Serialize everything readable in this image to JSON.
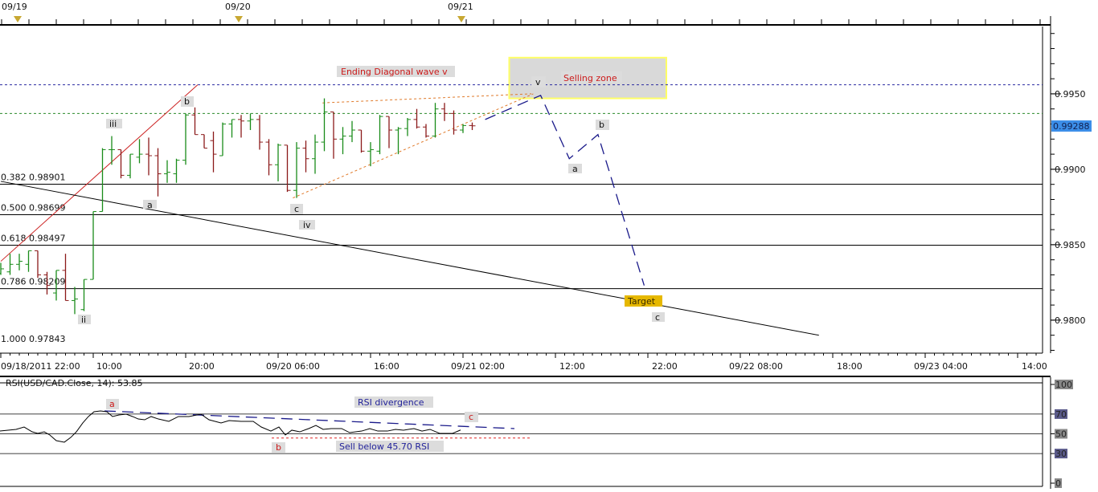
{
  "top_axis": {
    "dates": [
      "09/19",
      "09/20",
      "09/21"
    ]
  },
  "time_axis": {
    "labels": [
      "09/18/2011 22:00",
      "10:00",
      "20:00",
      "09/20 06:00",
      "16:00",
      "09/21 02:00",
      "12:00",
      "22:00",
      "09/22 08:00",
      "18:00",
      "09/23 04:00",
      "14:00"
    ]
  },
  "price_axis": {
    "ticks": [
      "0.9950",
      "0.9900",
      "0.9850",
      "0.9800"
    ],
    "last_price": "0.99288",
    "last_price_color": "#3c8ee8"
  },
  "fib_levels": [
    {
      "label": "0.382 0.98901",
      "price": 0.98901
    },
    {
      "label": "0.500 0.98699",
      "price": 0.98699
    },
    {
      "label": "0.618 0.98497",
      "price": 0.98497
    },
    {
      "label": "0.786 0.98209",
      "price": 0.98209
    },
    {
      "label": "1.000 0.97843",
      "price": 0.97843
    }
  ],
  "annotations": {
    "ending_diagonal": "Ending Diagonal wave v",
    "selling_zone": "Selling zone",
    "target": "Target",
    "waves": {
      "v": "v",
      "b1": "b",
      "iii": "iii",
      "a1": "a",
      "ii": "ii",
      "c1": "c",
      "iv": "iv",
      "a2": "a",
      "b2": "b",
      "c2": "c"
    }
  },
  "rsi": {
    "title": "RSI(USD/CAD.Close, 14): 53.85",
    "axis": [
      "100",
      "70",
      "50",
      "30",
      "0"
    ],
    "labels": {
      "a": "a",
      "b": "b",
      "c": "c",
      "divergence": "RSI divergence",
      "sell": "Sell below 45.70 RSI"
    }
  },
  "chart_data": [
    {
      "type": "ohlc",
      "title": "USD/CAD hourly",
      "x_unit": "hours since 09/18/2011 22:00",
      "ylim": [
        0.9776,
        0.9995
      ],
      "up_color": "#1a8c1a",
      "down_color": "#8b1a1a",
      "bars": [
        [
          0.9831,
          0.9838,
          0.983,
          0.9834
        ],
        [
          0.9832,
          0.9844,
          0.983,
          0.9837
        ],
        [
          0.9837,
          0.9844,
          0.9833,
          0.9839
        ],
        [
          0.9837,
          0.9846,
          0.9832,
          0.9846
        ],
        [
          0.9846,
          0.9846,
          0.9828,
          0.983
        ],
        [
          0.983,
          0.9832,
          0.9817,
          0.9823
        ],
        [
          0.9818,
          0.9833,
          0.9813,
          0.9833
        ],
        [
          0.9833,
          0.9844,
          0.9813,
          0.9813
        ],
        [
          0.9813,
          0.9822,
          0.9804,
          0.9814
        ],
        [
          0.9807,
          0.9827,
          0.9806,
          0.9827
        ],
        [
          0.9827,
          0.9872,
          0.9827,
          0.9872
        ],
        [
          0.9872,
          0.9914,
          0.9872,
          0.9913
        ],
        [
          0.9913,
          0.9922,
          0.9903,
          0.9913
        ],
        [
          0.9913,
          0.9913,
          0.9894,
          0.9896
        ],
        [
          0.9896,
          0.991,
          0.9894,
          0.991
        ],
        [
          0.9908,
          0.992,
          0.9904,
          0.991
        ],
        [
          0.991,
          0.9921,
          0.9896,
          0.9909
        ],
        [
          0.9909,
          0.9914,
          0.9882,
          0.9897
        ],
        [
          0.9897,
          0.9906,
          0.9891,
          0.9898
        ],
        [
          0.9897,
          0.9907,
          0.9891,
          0.9906
        ],
        [
          0.9906,
          0.9937,
          0.9903,
          0.9936
        ],
        [
          0.9936,
          0.9941,
          0.9923,
          0.9923
        ],
        [
          0.9923,
          0.9923,
          0.9914,
          0.9914
        ],
        [
          0.9919,
          0.9925,
          0.9898,
          0.991
        ],
        [
          0.9909,
          0.9931,
          0.9909,
          0.993
        ],
        [
          0.993,
          0.9933,
          0.9921,
          0.9933
        ],
        [
          0.9933,
          0.9936,
          0.9921,
          0.9932
        ],
        [
          0.9932,
          0.9937,
          0.9926,
          0.9933
        ],
        [
          0.9933,
          0.9936,
          0.9913,
          0.9918
        ],
        [
          0.9918,
          0.992,
          0.9896,
          0.9903
        ],
        [
          0.9903,
          0.9917,
          0.9892,
          0.9916
        ],
        [
          0.9916,
          0.9916,
          0.9885,
          0.9886
        ],
        [
          0.9886,
          0.9918,
          0.9881,
          0.9914
        ],
        [
          0.9914,
          0.9919,
          0.9898,
          0.9907
        ],
        [
          0.9907,
          0.9923,
          0.9897,
          0.9918
        ],
        [
          0.9918,
          0.9947,
          0.9912,
          0.9938
        ],
        [
          0.9938,
          0.9938,
          0.9907,
          0.992
        ],
        [
          0.992,
          0.9928,
          0.991,
          0.9922
        ],
        [
          0.9922,
          0.9932,
          0.9918,
          0.9926
        ],
        [
          0.9926,
          0.9926,
          0.9911,
          0.9912
        ],
        [
          0.9912,
          0.9918,
          0.9902,
          0.9913
        ],
        [
          0.9912,
          0.9936,
          0.991,
          0.9935
        ],
        [
          0.9935,
          0.9935,
          0.9914,
          0.9926
        ],
        [
          0.9926,
          0.9928,
          0.991,
          0.9927
        ],
        [
          0.9927,
          0.9934,
          0.9922,
          0.9933
        ],
        [
          0.9933,
          0.994,
          0.9927,
          0.9928
        ],
        [
          0.9928,
          0.993,
          0.9921,
          0.9922
        ],
        [
          0.9922,
          0.9944,
          0.9921,
          0.994
        ],
        [
          0.994,
          0.9944,
          0.9932,
          0.9937
        ],
        [
          0.9937,
          0.9939,
          0.9923,
          0.9926
        ],
        [
          0.9926,
          0.993,
          0.9924,
          0.9929
        ],
        [
          0.9929,
          0.9931,
          0.9926,
          0.99288
        ]
      ],
      "hlines": [
        {
          "price": 0.9956,
          "color": "#2a2aa0",
          "style": "dashed"
        },
        {
          "price": 0.9937,
          "color": "#2a8a2a",
          "style": "dashed"
        }
      ],
      "trendlines": [
        {
          "name": "red-trendline",
          "color": "#cc2222",
          "dash": "",
          "points": [
            [
              0,
              0.9839
            ],
            [
              21.3,
              0.9956
            ]
          ]
        },
        {
          "name": "black-trendline",
          "color": "#000000",
          "dash": "",
          "points": [
            [
              0,
              0.9892
            ],
            [
              88.5,
              0.979
            ]
          ]
        },
        {
          "name": "diagonal-upper-line",
          "color": "#e07a2a",
          "dash": "3,3",
          "points": [
            [
              34.8,
              0.9944
            ],
            [
              57.4,
              0.995
            ]
          ]
        },
        {
          "name": "diagonal-lower-line",
          "color": "#e07a2a",
          "dash": "3,3",
          "points": [
            [
              31.6,
              0.9881
            ],
            [
              57.6,
              0.995
            ]
          ]
        },
        {
          "name": "projection-path",
          "color": "#1a1a8a",
          "dash": "14,8",
          "points": [
            [
              52.4,
              0.9933
            ],
            [
              58.4,
              0.9949
            ],
            [
              61.5,
              0.9907
            ],
            [
              64.6,
              0.9923
            ],
            [
              69.6,
              0.9823
            ]
          ]
        }
      ],
      "selling_zone": {
        "h0": 55,
        "h1": 72,
        "p0": 0.9947,
        "p1": 0.9974,
        "fill": "#d9d9d9",
        "border": "#ffff66"
      }
    },
    {
      "type": "line",
      "title": "RSI(USD/CAD.Close, 14)",
      "ylim": [
        0,
        100
      ],
      "levels": [
        70,
        50,
        30
      ],
      "x": [
        0,
        20,
        30,
        40,
        47,
        55,
        62,
        70,
        80,
        88,
        95,
        103,
        110,
        117,
        125,
        133,
        140,
        148,
        157,
        165,
        172,
        180,
        188,
        197,
        210,
        222,
        235,
        250,
        260,
        275,
        285,
        300,
        315,
        325,
        337,
        347,
        355,
        363,
        373,
        384,
        393,
        402,
        412,
        425,
        435,
        450,
        460,
        470,
        482,
        492,
        502,
        515,
        525,
        535,
        547,
        563,
        573
      ],
      "x_unit": "px-free index scaled: minutes/5.2 since start",
      "values": [
        52.8,
        54.5,
        56.9,
        52.0,
        50.4,
        52.0,
        48.8,
        43.1,
        41.5,
        46.3,
        52.0,
        61.0,
        67.5,
        72.4,
        73.2,
        72.4,
        67.5,
        69.1,
        69.9,
        67.5,
        65.0,
        64.2,
        67.5,
        65.0,
        62.6,
        67.5,
        67.5,
        69.9,
        64.2,
        61.0,
        63.4,
        62.6,
        62.6,
        56.9,
        52.8,
        56.9,
        48.8,
        53.7,
        52.0,
        55.3,
        58.5,
        54.5,
        55.3,
        55.3,
        51.2,
        52.8,
        55.3,
        52.8,
        52.8,
        54.5,
        53.7,
        55.3,
        52.8,
        54.5,
        50.4,
        50.4,
        53.85
      ],
      "divergence_line": [
        [
          130,
          73.2
        ],
        [
          640,
          55.3
        ]
      ],
      "sell_level": 45.7
    }
  ]
}
